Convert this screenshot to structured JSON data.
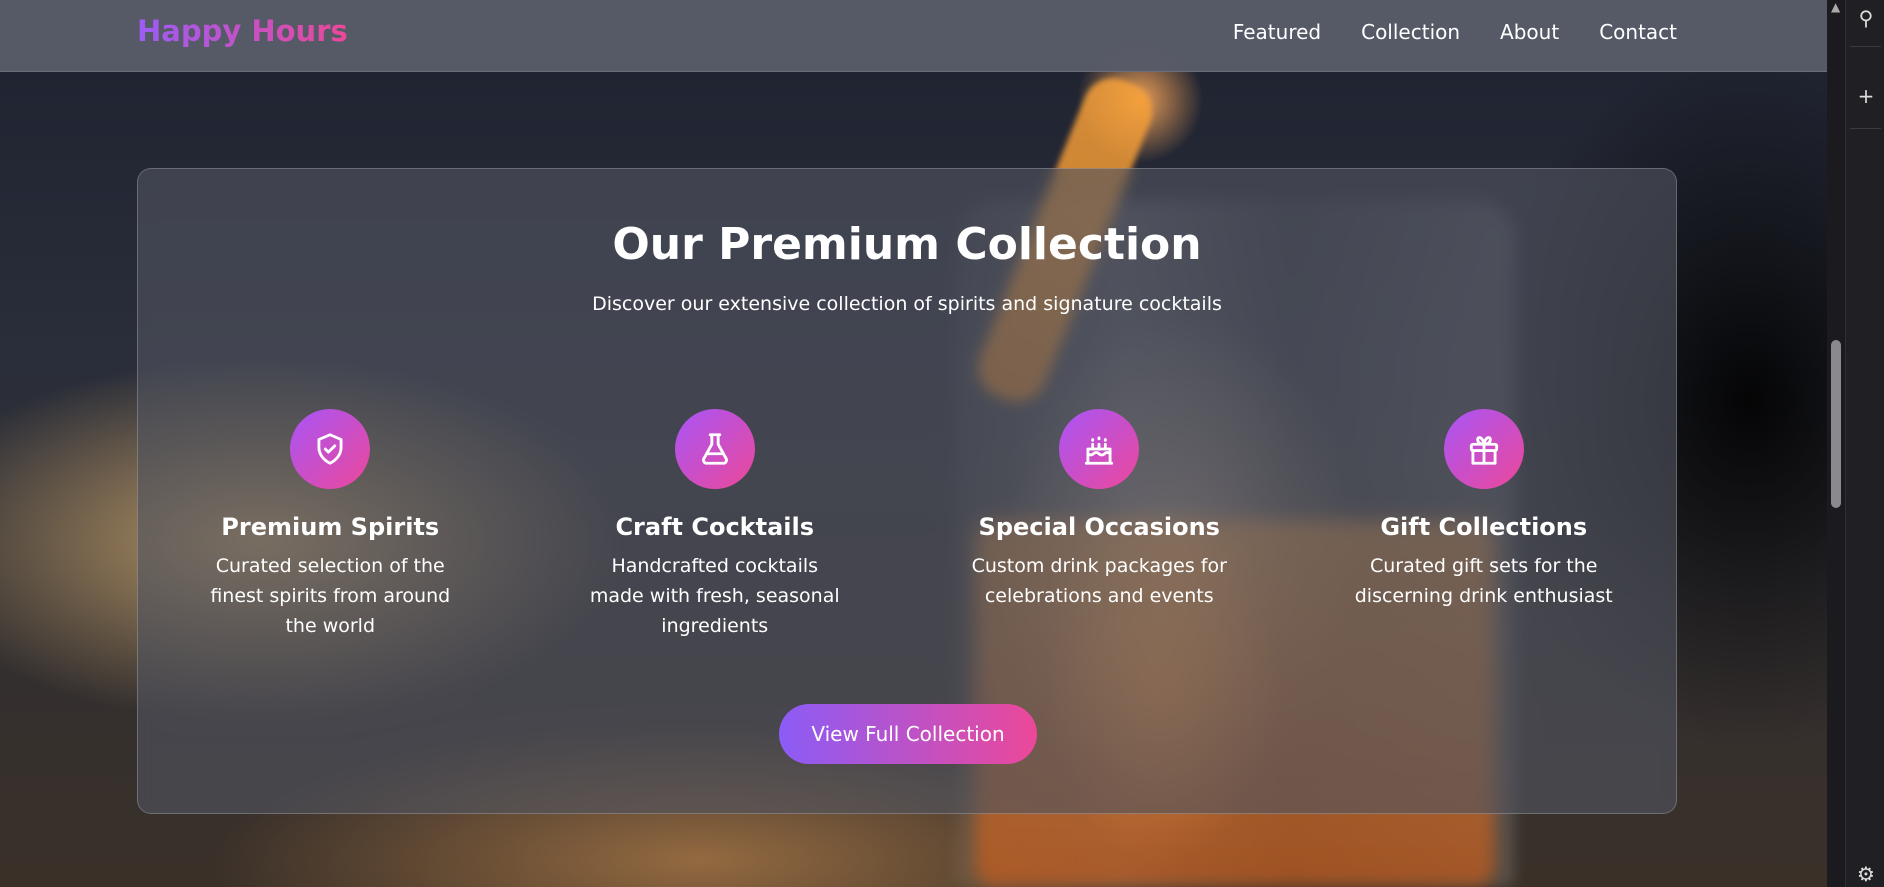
{
  "nav": {
    "brand": "Happy Hours",
    "links": [
      "Featured",
      "Collection",
      "About",
      "Contact"
    ]
  },
  "section": {
    "title": "Our Premium Collection",
    "subtitle": "Discover our extensive collection of spirits and signature cocktails",
    "features": [
      {
        "icon": "shield-check-icon",
        "title": "Premium Spirits",
        "desc": "Curated selection of the finest spirits from around the world"
      },
      {
        "icon": "flask-icon",
        "title": "Craft Cocktails",
        "desc": "Handcrafted cocktails made with fresh, seasonal ingredients"
      },
      {
        "icon": "cake-icon",
        "title": "Special Occasions",
        "desc": "Custom drink packages for celebrations and events"
      },
      {
        "icon": "gift-icon",
        "title": "Gift Collections",
        "desc": "Curated gift sets for the discerning drink enthusiast"
      }
    ],
    "cta_label": "View Full Collection"
  },
  "colors": {
    "accent_start": "#8b5cf6",
    "accent_end": "#ec4899"
  }
}
